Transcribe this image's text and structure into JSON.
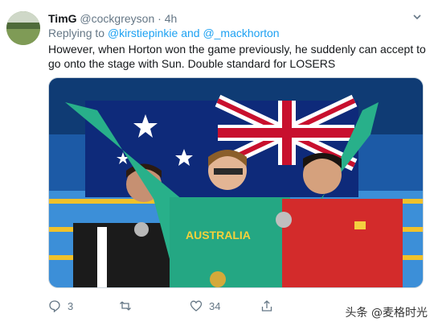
{
  "tweet": {
    "display_name": "TimG",
    "handle": "@cockgreyson",
    "separator": "·",
    "time": "4h",
    "replying_prefix": "Replying to",
    "mention_1": "@kirstiepinkie",
    "mention_joiner": "and",
    "mention_2": "@_mackhorton",
    "text": "However, when Horton won the game previously, he suddenly can accept to go onto the stage with Sun. Double standard for LOSERS",
    "photo_text": "AUSTRALIA",
    "stats": {
      "replies": "3",
      "retweets": "",
      "likes": "34"
    }
  },
  "icons": {
    "caret": "chevron-down-icon",
    "reply": "reply-icon",
    "retweet": "retweet-icon",
    "like": "heart-icon",
    "share": "share-icon"
  },
  "watermark": "头条 @麦格时光",
  "colors": {
    "link": "#1da1f2",
    "muted": "#657786",
    "text": "#14171a"
  }
}
